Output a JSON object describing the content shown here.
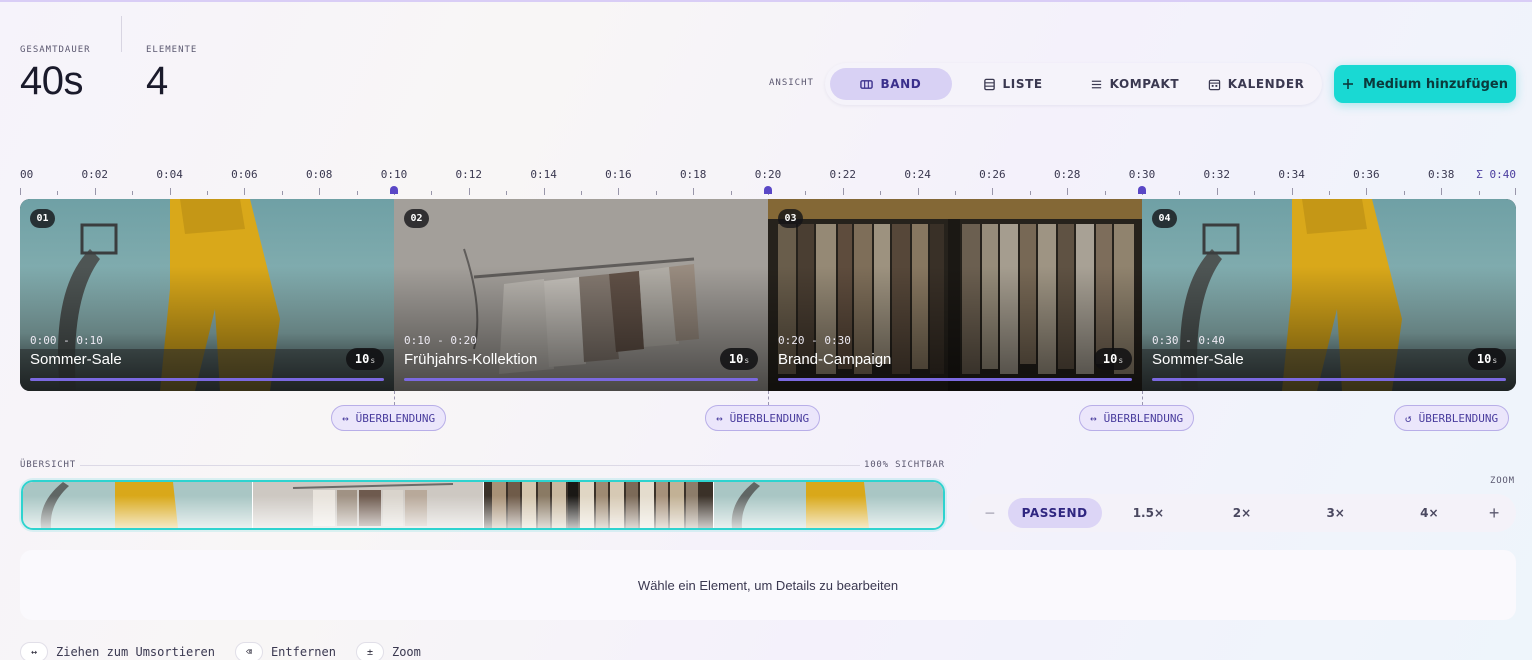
{
  "stats": {
    "duration_label": "GESAMTDAUER",
    "duration_value": "40s",
    "elements_label": "ELEMENTE",
    "elements_value": "4"
  },
  "view": {
    "label": "ANSICHT",
    "options": [
      {
        "label": "BAND",
        "icon": "film-icon",
        "active": true
      },
      {
        "label": "LISTE",
        "icon": "list-icon",
        "active": false
      },
      {
        "label": "KOMPAKT",
        "icon": "menu-icon",
        "active": false
      },
      {
        "label": "KALENDER",
        "icon": "calendar-icon",
        "active": false
      }
    ]
  },
  "add_button": {
    "label": "Medium hinzufügen",
    "icon": "plus-icon"
  },
  "ruler": {
    "labels": [
      "00",
      "0:02",
      "0:04",
      "0:06",
      "0:08",
      "0:10",
      "0:12",
      "0:14",
      "0:16",
      "0:18",
      "0:20",
      "0:22",
      "0:24",
      "0:26",
      "0:28",
      "0:30",
      "0:32",
      "0:34",
      "0:36",
      "0:38"
    ],
    "end_label": "Σ 0:40",
    "total_seconds": 40,
    "markers_seconds": [
      10,
      20,
      30
    ]
  },
  "clips": [
    {
      "index": "01",
      "range": "0:00 - 0:10",
      "title": "Sommer-Sale",
      "duration": "10",
      "unit": "s",
      "image": "yellow-outfit"
    },
    {
      "index": "02",
      "range": "0:10 - 0:20",
      "title": "Frühjahrs-Kollektion",
      "duration": "10",
      "unit": "s",
      "image": "clothing-rack"
    },
    {
      "index": "03",
      "range": "0:20 - 0:30",
      "title": "Brand-Campaign",
      "duration": "10",
      "unit": "s",
      "image": "store-rack"
    },
    {
      "index": "04",
      "range": "0:30 - 0:40",
      "title": "Sommer-Sale",
      "duration": "10",
      "unit": "s",
      "image": "yellow-outfit"
    }
  ],
  "transitions": [
    {
      "label": "ÜBERBLENDUNG",
      "icon": "swap-icon"
    },
    {
      "label": "ÜBERBLENDUNG",
      "icon": "swap-icon"
    },
    {
      "label": "ÜBERBLENDUNG",
      "icon": "swap-icon"
    },
    {
      "label": "ÜBERBLENDUNG",
      "icon": "loop-icon"
    }
  ],
  "overview": {
    "label": "ÜBERSICHT",
    "visible": "100% SICHTBAR"
  },
  "zoom": {
    "label": "ZOOM",
    "options": [
      {
        "label": "PASSEND",
        "active": true
      },
      {
        "label": "1.5×",
        "active": false
      },
      {
        "label": "2×",
        "active": false
      },
      {
        "label": "3×",
        "active": false
      },
      {
        "label": "4×",
        "active": false
      }
    ],
    "minus": "−",
    "plus": "+"
  },
  "details_placeholder": "Wähle ein Element, um Details zu bearbeiten",
  "hints": [
    {
      "key": "↔",
      "text": "Ziehen zum Umsortieren"
    },
    {
      "key": "⌫",
      "text": "Entfernen"
    },
    {
      "key": "±",
      "text": "Zoom"
    }
  ],
  "colors": {
    "accent": "#5a47c6",
    "cta": "#19d9d3"
  }
}
